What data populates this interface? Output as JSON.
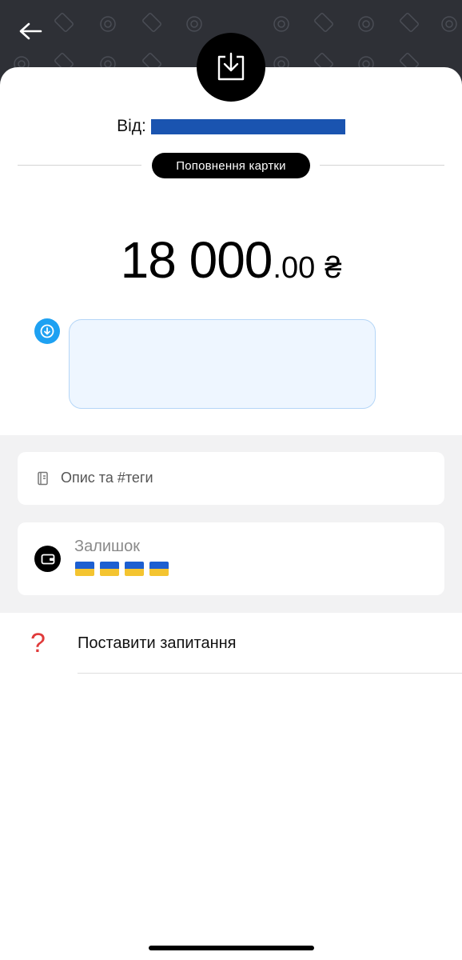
{
  "header": {
    "back_icon": "arrow-left-icon",
    "badge_icon": "download-tray-icon"
  },
  "transaction": {
    "from_label": "Від:",
    "type_label": "Поповнення картки",
    "amount_int": "18 000",
    "amount_dec": ".00",
    "currency": "₴"
  },
  "comment": {
    "icon": "chat-download-icon",
    "text": ""
  },
  "description": {
    "icon": "notes-icon",
    "placeholder": "Опис та #теги"
  },
  "balance": {
    "icon": "wallet-icon",
    "label": "Залишок",
    "flags": [
      "ua-flag",
      "ua-flag",
      "ua-flag",
      "ua-flag"
    ]
  },
  "help": {
    "icon": "question-icon",
    "label": "Поставити запитання"
  },
  "colors": {
    "header_bg": "#2e3036",
    "redaction": "#1a54b0",
    "accent_blue": "#1ea1f2",
    "question_red": "#e03a3a"
  }
}
